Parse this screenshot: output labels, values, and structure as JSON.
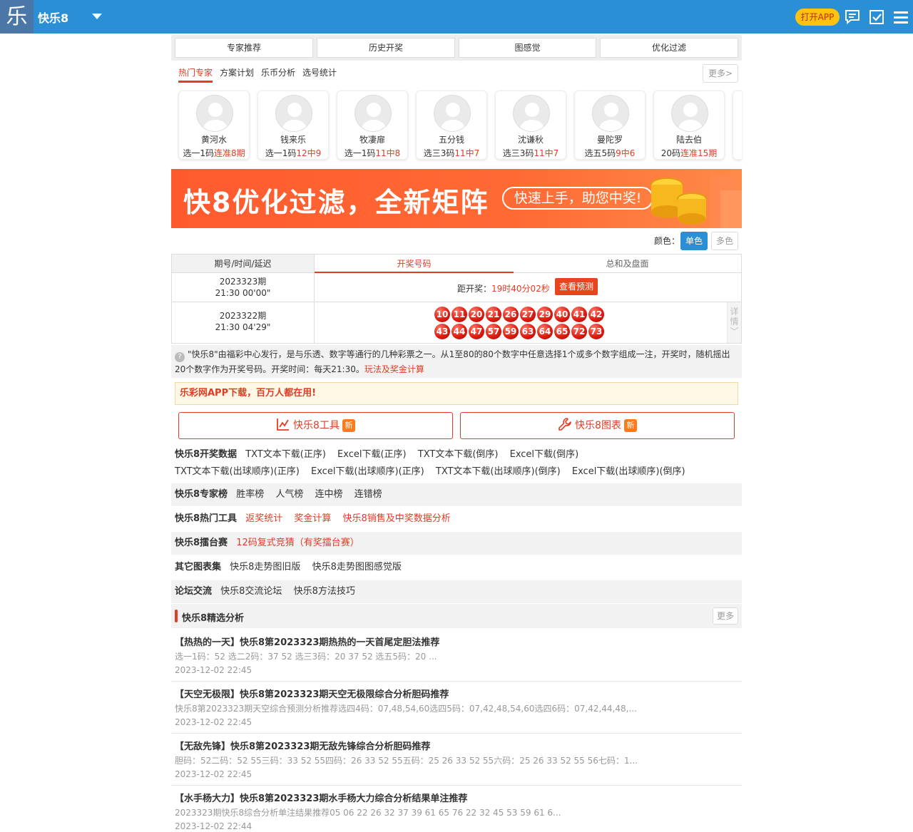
{
  "header": {
    "logo_glyph": "乐",
    "title": "快乐8",
    "open_app": "打开APP"
  },
  "nav": [
    "专家推荐",
    "历史开奖",
    "图感觉",
    "优化过滤"
  ],
  "expert_tabs": [
    "热门专家",
    "方案计划",
    "乐币分析",
    "选号统计"
  ],
  "more_label": "更多>",
  "experts": [
    {
      "name": "黄河水",
      "stat_prefix": "选一1码",
      "stat_hl": "连准8期"
    },
    {
      "name": "钱来乐",
      "stat_prefix": "选一1码",
      "stat_hl": "12中9"
    },
    {
      "name": "牧凄扉",
      "stat_prefix": "选一1码",
      "stat_hl": "11中8"
    },
    {
      "name": "五分钱",
      "stat_prefix": "选三3码",
      "stat_hl": "11中7"
    },
    {
      "name": "沈谦秋",
      "stat_prefix": "选三3码",
      "stat_hl": "11中7"
    },
    {
      "name": "曼陀罗",
      "stat_prefix": "选五5码",
      "stat_hl": "9中6"
    },
    {
      "name": "陆去伯",
      "stat_prefix": "20码",
      "stat_hl": "连准15期"
    }
  ],
  "banner": {
    "title": "快8优化过滤，全新矩阵",
    "pill": "快速上手，助您中奖!"
  },
  "color": {
    "label": "颜色：",
    "single": "单色",
    "multi": "多色"
  },
  "draw_table": {
    "head_left": "期号/时间/延迟",
    "tabs": [
      "开奖号码",
      "总和及盘面"
    ],
    "row1": {
      "period": "2023323期",
      "time": "21:30 00'00\"",
      "countdown_label": "距开奖：",
      "countdown": "19时40分02秒",
      "predict_btn": "查看预测"
    },
    "row2": {
      "period": "2023322期",
      "time": "21:30 04'29\"",
      "balls": [
        "10",
        "11",
        "20",
        "21",
        "26",
        "27",
        "29",
        "40",
        "41",
        "42",
        "43",
        "44",
        "47",
        "57",
        "59",
        "63",
        "64",
        "65",
        "72",
        "73"
      ],
      "detail": [
        "详",
        "情",
        "﹀"
      ]
    }
  },
  "intro": {
    "text": "\"快乐8\"由福彩中心发行，是与乐透、数字等通行的几种彩票之一。从1至80的80个数字中任意选择1个或多个数字组成一注，开奖时，随机摇出20个数字作为开奖号码。开奖时间：每天21:30。",
    "link": "玩法及奖金计算"
  },
  "app_download": "乐彩网APP下载，百万人都在用!",
  "tools": [
    {
      "label": "快乐8工具",
      "badge": "新"
    },
    {
      "label": "快乐8图表",
      "badge": "新"
    }
  ],
  "data_rows": {
    "open_data": {
      "title": "快乐8开奖数据",
      "line1": [
        "TXT文本下载(正序)",
        "Excel下载(正序)",
        "TXT文本下载(倒序)",
        "Excel下载(倒序)"
      ],
      "line2": [
        "TXT文本下载(出球顺序)(正序)",
        "Excel下载(出球顺序)(正序)",
        "TXT文本下载(出球顺序)(倒序)",
        "Excel下载(出球顺序)(倒序)"
      ]
    },
    "rank": {
      "title": "快乐8专家榜",
      "links": [
        "胜率榜",
        "人气榜",
        "连中榜",
        "连错榜"
      ]
    },
    "hot_tools": {
      "title": "快乐8热门工具",
      "links": [
        "返奖统计",
        "奖金计算",
        "快乐8销售及中奖数据分析"
      ]
    },
    "arena": {
      "title": "快乐8擂台赛",
      "links": [
        "12码复式竞猜（有奖擂台赛）"
      ]
    },
    "charts": {
      "title": "其它图表集",
      "links": [
        "快乐8走势图旧版",
        "快乐8走势图图感觉版"
      ]
    },
    "forum": {
      "title": "论坛交流",
      "links": [
        "快乐8交流论坛",
        "快乐8方法技巧"
      ]
    }
  },
  "analysis": {
    "title": "快乐8精选分析",
    "more": "更多",
    "articles": [
      {
        "title": "【热热的一天】快乐8第2023323期热热的一天首尾定胆法推荐",
        "snippet": "选一1码：52  选二2码：37 52  选三3码：20 37 52  选五5码：20 ...",
        "date": "2023-12-02 22:45"
      },
      {
        "title": "【天空无极限】快乐8第2023323期天空无极限综合分析胆码推荐",
        "snippet": "快乐8第2023323期天空综合预测分析推荐选四4码：07,48,54,60选四5码：07,42,48,54,60选四6码：07,42,44,48,...",
        "date": "2023-12-02 22:45"
      },
      {
        "title": "【无敌先锋】快乐8第2023323期无敌先锋综合分析胆码推荐",
        "snippet": "胆码：52二码：52 55三码：33 52 55四码：26 33 52 55五码：25 26 33 52 55六码：25 26 33 52 55 56七码：1...",
        "date": "2023-12-02 22:45"
      },
      {
        "title": "【水手杨大力】快乐8第2023323期水手杨大力综合分析结果单注推荐",
        "snippet": "2023323期快乐8综合分析单注结果推荐05 06 22 26 32 37 39 61 65 76   22 32 45 53 59 61 6...",
        "date": "2023-12-02 22:44"
      }
    ]
  },
  "colors": {
    "header_blue": "#2b8fd6",
    "accent_red": "#e03c26",
    "badge_orange": "#ff7a1a",
    "app_yellow": "#ffc20e"
  },
  "icons": [
    "logo-icon",
    "caret-down-icon",
    "message-icon",
    "checkbox-icon",
    "menu-icon",
    "avatar-placeholder-icon",
    "chart-line-icon",
    "wrench-icon",
    "help-icon"
  ]
}
